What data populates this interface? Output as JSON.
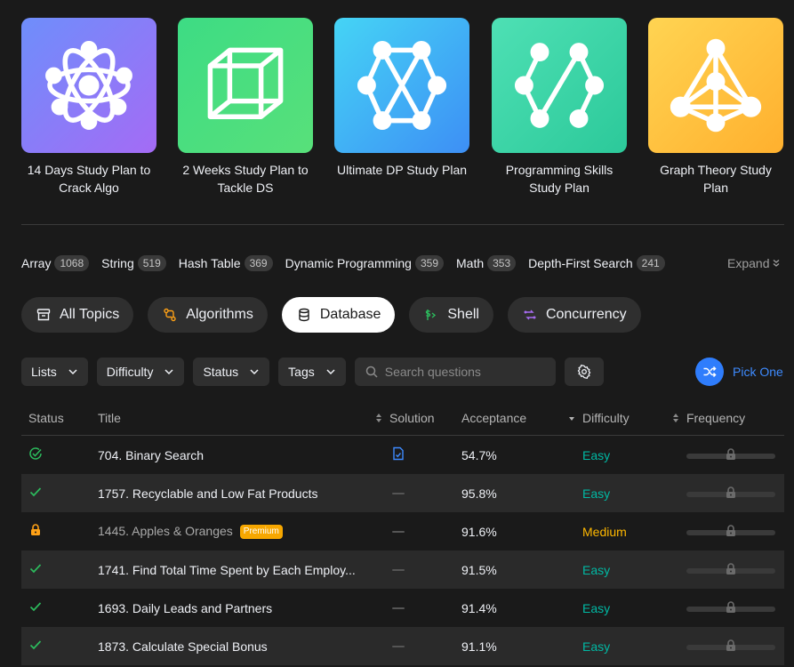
{
  "study_plans": [
    {
      "label": "14 Days Study Plan to Crack Algo",
      "icon": "atom-icon",
      "gradient": [
        "#6e8efb",
        "#a46bf5"
      ]
    },
    {
      "label": "2 Weeks Study Plan to Tackle DS",
      "icon": "cube-icon",
      "gradient": [
        "#3ddc84",
        "#58e07a"
      ]
    },
    {
      "label": "Ultimate DP Study Plan",
      "icon": "dp-graph-icon",
      "gradient": [
        "#45d4f5",
        "#3d8ff5"
      ]
    },
    {
      "label": "Programming Skills Study Plan",
      "icon": "zigzag-graph-icon",
      "gradient": [
        "#4ee0b4",
        "#2cc99a"
      ]
    },
    {
      "label": "Graph Theory Study Plan",
      "icon": "triangle-graph-icon",
      "gradient": [
        "#ffd452",
        "#ffb02e"
      ]
    }
  ],
  "tags": [
    {
      "name": "Array",
      "count": "1068"
    },
    {
      "name": "String",
      "count": "519"
    },
    {
      "name": "Hash Table",
      "count": "369"
    },
    {
      "name": "Dynamic Programming",
      "count": "359"
    },
    {
      "name": "Math",
      "count": "353"
    },
    {
      "name": "Depth-First Search",
      "count": "241"
    }
  ],
  "expand_label": "Expand",
  "categories": [
    {
      "label": "All Topics",
      "icon": "archive-icon",
      "active": false
    },
    {
      "label": "Algorithms",
      "icon": "algorithm-icon",
      "active": false
    },
    {
      "label": "Database",
      "icon": "database-icon",
      "active": true
    },
    {
      "label": "Shell",
      "icon": "shell-icon",
      "active": false
    },
    {
      "label": "Concurrency",
      "icon": "concurrency-icon",
      "active": false
    }
  ],
  "filters": [
    "Lists",
    "Difficulty",
    "Status",
    "Tags"
  ],
  "search": {
    "placeholder": "Search questions"
  },
  "pick_one_label": "Pick One",
  "table": {
    "headers": {
      "status": "Status",
      "title": "Title",
      "solution": "Solution",
      "acceptance": "Acceptance",
      "difficulty": "Difficulty",
      "frequency": "Frequency"
    },
    "rows": [
      {
        "status": "attempted",
        "title": "704. Binary Search",
        "solution": "doc",
        "acceptance": "54.7%",
        "difficulty": "Easy",
        "premium": false
      },
      {
        "status": "solved",
        "title": "1757. Recyclable and Low Fat Products",
        "solution": "none",
        "acceptance": "95.8%",
        "difficulty": "Easy",
        "premium": false
      },
      {
        "status": "locked",
        "title": "1445. Apples & Oranges",
        "solution": "none",
        "acceptance": "91.6%",
        "difficulty": "Medium",
        "premium": true,
        "premium_label": "Premium"
      },
      {
        "status": "solved",
        "title": "1741. Find Total Time Spent by Each Employ...",
        "solution": "none",
        "acceptance": "91.5%",
        "difficulty": "Easy",
        "premium": false
      },
      {
        "status": "solved",
        "title": "1693. Daily Leads and Partners",
        "solution": "none",
        "acceptance": "91.4%",
        "difficulty": "Easy",
        "premium": false
      },
      {
        "status": "solved",
        "title": "1873. Calculate Special Bonus",
        "solution": "none",
        "acceptance": "91.1%",
        "difficulty": "Easy",
        "premium": false
      }
    ]
  },
  "colors": {
    "easy": "#00b8a3",
    "medium": "#ffb800",
    "accent": "#2f7dfc",
    "solved": "#2cbb5d",
    "premium": "#f7a700"
  }
}
